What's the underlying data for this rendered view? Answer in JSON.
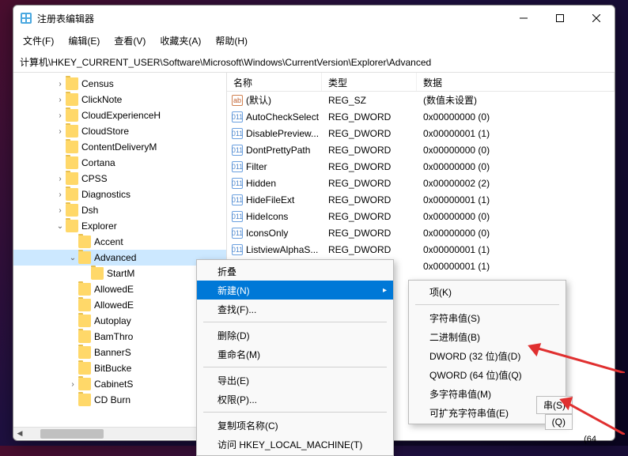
{
  "window": {
    "title": "注册表编辑器"
  },
  "menu": {
    "file": "文件(F)",
    "edit": "编辑(E)",
    "view": "查看(V)",
    "fav": "收藏夹(A)",
    "help": "帮助(H)"
  },
  "address": "计算机\\HKEY_CURRENT_USER\\Software\\Microsoft\\Windows\\CurrentVersion\\Explorer\\Advanced",
  "tree": [
    {
      "indent": 3,
      "caret": ">",
      "label": "Census"
    },
    {
      "indent": 3,
      "caret": ">",
      "label": "ClickNote"
    },
    {
      "indent": 3,
      "caret": ">",
      "label": "CloudExperienceH"
    },
    {
      "indent": 3,
      "caret": ">",
      "label": "CloudStore"
    },
    {
      "indent": 3,
      "caret": "",
      "label": "ContentDeliveryM"
    },
    {
      "indent": 3,
      "caret": "",
      "label": "Cortana"
    },
    {
      "indent": 3,
      "caret": ">",
      "label": "CPSS"
    },
    {
      "indent": 3,
      "caret": ">",
      "label": "Diagnostics"
    },
    {
      "indent": 3,
      "caret": ">",
      "label": "Dsh"
    },
    {
      "indent": 3,
      "caret": "v",
      "label": "Explorer"
    },
    {
      "indent": 4,
      "caret": "",
      "label": "Accent"
    },
    {
      "indent": 4,
      "caret": "v",
      "label": "Advanced",
      "selected": true
    },
    {
      "indent": 5,
      "caret": "",
      "label": "StartM"
    },
    {
      "indent": 4,
      "caret": "",
      "label": "AllowedE"
    },
    {
      "indent": 4,
      "caret": "",
      "label": "AllowedE"
    },
    {
      "indent": 4,
      "caret": "",
      "label": "Autoplay"
    },
    {
      "indent": 4,
      "caret": "",
      "label": "BamThro"
    },
    {
      "indent": 4,
      "caret": "",
      "label": "BannerS"
    },
    {
      "indent": 4,
      "caret": "",
      "label": "BitBucke"
    },
    {
      "indent": 4,
      "caret": ">",
      "label": "CabinetS"
    },
    {
      "indent": 4,
      "caret": "",
      "label": "CD Burn"
    }
  ],
  "list": {
    "headers": {
      "name": "名称",
      "type": "类型",
      "data": "数据"
    },
    "rows": [
      {
        "icon": "str",
        "name": "(默认)",
        "type": "REG_SZ",
        "data": "(数值未设置)"
      },
      {
        "icon": "bin",
        "name": "AutoCheckSelect",
        "type": "REG_DWORD",
        "data": "0x00000000 (0)"
      },
      {
        "icon": "bin",
        "name": "DisablePreview...",
        "type": "REG_DWORD",
        "data": "0x00000001 (1)"
      },
      {
        "icon": "bin",
        "name": "DontPrettyPath",
        "type": "REG_DWORD",
        "data": "0x00000000 (0)"
      },
      {
        "icon": "bin",
        "name": "Filter",
        "type": "REG_DWORD",
        "data": "0x00000000 (0)"
      },
      {
        "icon": "bin",
        "name": "Hidden",
        "type": "REG_DWORD",
        "data": "0x00000002 (2)"
      },
      {
        "icon": "bin",
        "name": "HideFileExt",
        "type": "REG_DWORD",
        "data": "0x00000001 (1)"
      },
      {
        "icon": "bin",
        "name": "HideIcons",
        "type": "REG_DWORD",
        "data": "0x00000000 (0)"
      },
      {
        "icon": "bin",
        "name": "IconsOnly",
        "type": "REG_DWORD",
        "data": "0x00000000 (0)"
      },
      {
        "icon": "bin",
        "name": "ListviewAlphaS...",
        "type": "REG_DWORD",
        "data": "0x00000001 (1)"
      },
      {
        "icon": "bin",
        "name": "",
        "type": "",
        "data": "0x00000001 (1)"
      }
    ]
  },
  "context1": {
    "collapse": "折叠",
    "new": "新建(N)",
    "find": "查找(F)...",
    "delete": "删除(D)",
    "rename": "重命名(M)",
    "export": "导出(E)",
    "perm": "权限(P)...",
    "copykey": "复制项名称(C)",
    "goto": "访问 HKEY_LOCAL_MACHINE(T)"
  },
  "context2": {
    "key": "项(K)",
    "string": "字符串值(S)",
    "binary": "二进制值(B)",
    "dword": "DWORD (32 位)值(D)",
    "qword": "QWORD (64 位)值(Q)",
    "mstring": "多字符串值(M)",
    "estring": "可扩充字符串值(E)"
  },
  "partial": {
    "s": "串(S)",
    "q": "(Q)",
    "x64": "(64"
  }
}
